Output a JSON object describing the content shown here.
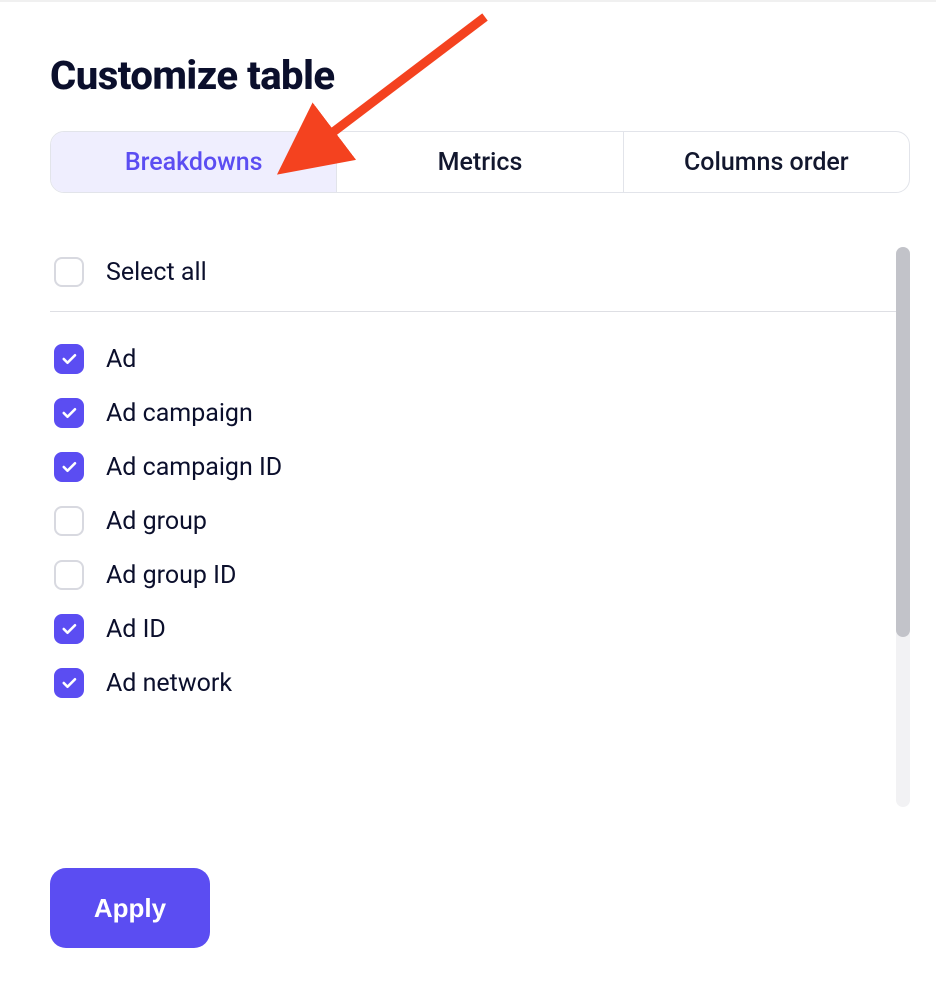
{
  "title": "Customize table",
  "tabs": [
    {
      "label": "Breakdowns",
      "active": true
    },
    {
      "label": "Metrics",
      "active": false
    },
    {
      "label": "Columns order",
      "active": false
    }
  ],
  "select_all": {
    "label": "Select all",
    "checked": false
  },
  "breakdowns": [
    {
      "label": "Ad",
      "checked": true
    },
    {
      "label": "Ad campaign",
      "checked": true
    },
    {
      "label": "Ad campaign ID",
      "checked": true
    },
    {
      "label": "Ad group",
      "checked": false
    },
    {
      "label": "Ad group ID",
      "checked": false
    },
    {
      "label": "Ad ID",
      "checked": true
    },
    {
      "label": "Ad network",
      "checked": true
    }
  ],
  "apply_label": "Apply",
  "colors": {
    "accent": "#5b4df2",
    "tab_active_bg": "#efeefe",
    "border": "#e2e4ea",
    "text": "#0b0f2c",
    "scroll_thumb": "#c2c3c9",
    "annotation_arrow": "#f4421f"
  }
}
